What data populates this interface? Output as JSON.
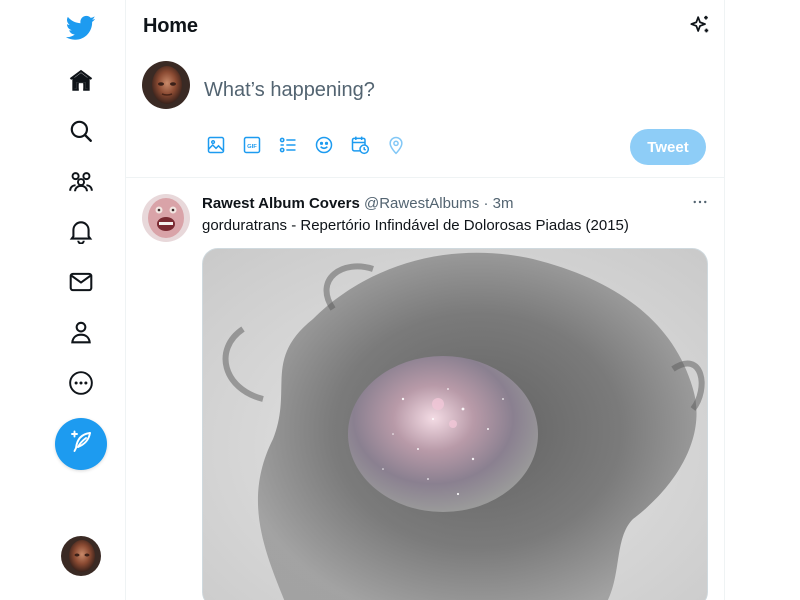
{
  "nav": {
    "items": [
      {
        "icon": "home-icon"
      },
      {
        "icon": "search-icon"
      },
      {
        "icon": "communities-icon"
      },
      {
        "icon": "bell-icon"
      },
      {
        "icon": "mail-icon"
      },
      {
        "icon": "profile-icon"
      },
      {
        "icon": "more-icon"
      }
    ]
  },
  "header": {
    "title": "Home"
  },
  "composer": {
    "placeholder": "What’s happening?",
    "tweet_button": "Tweet",
    "tools": [
      "image-icon",
      "gif-icon",
      "poll-icon",
      "emoji-icon",
      "schedule-icon",
      "location-icon"
    ]
  },
  "tweet": {
    "author_name": "Rawest Album Covers",
    "author_handle": "@RawestAlbums",
    "separator": "·",
    "time": "3m",
    "text": "gorduratrans - Repertório Infindável de Dolorosas Piadas (2015)"
  },
  "colors": {
    "accent": "#1d9bf0",
    "tweet_button_disabled": "#8ecdf7",
    "secondary_text": "#536471",
    "border": "#eff3f4"
  }
}
